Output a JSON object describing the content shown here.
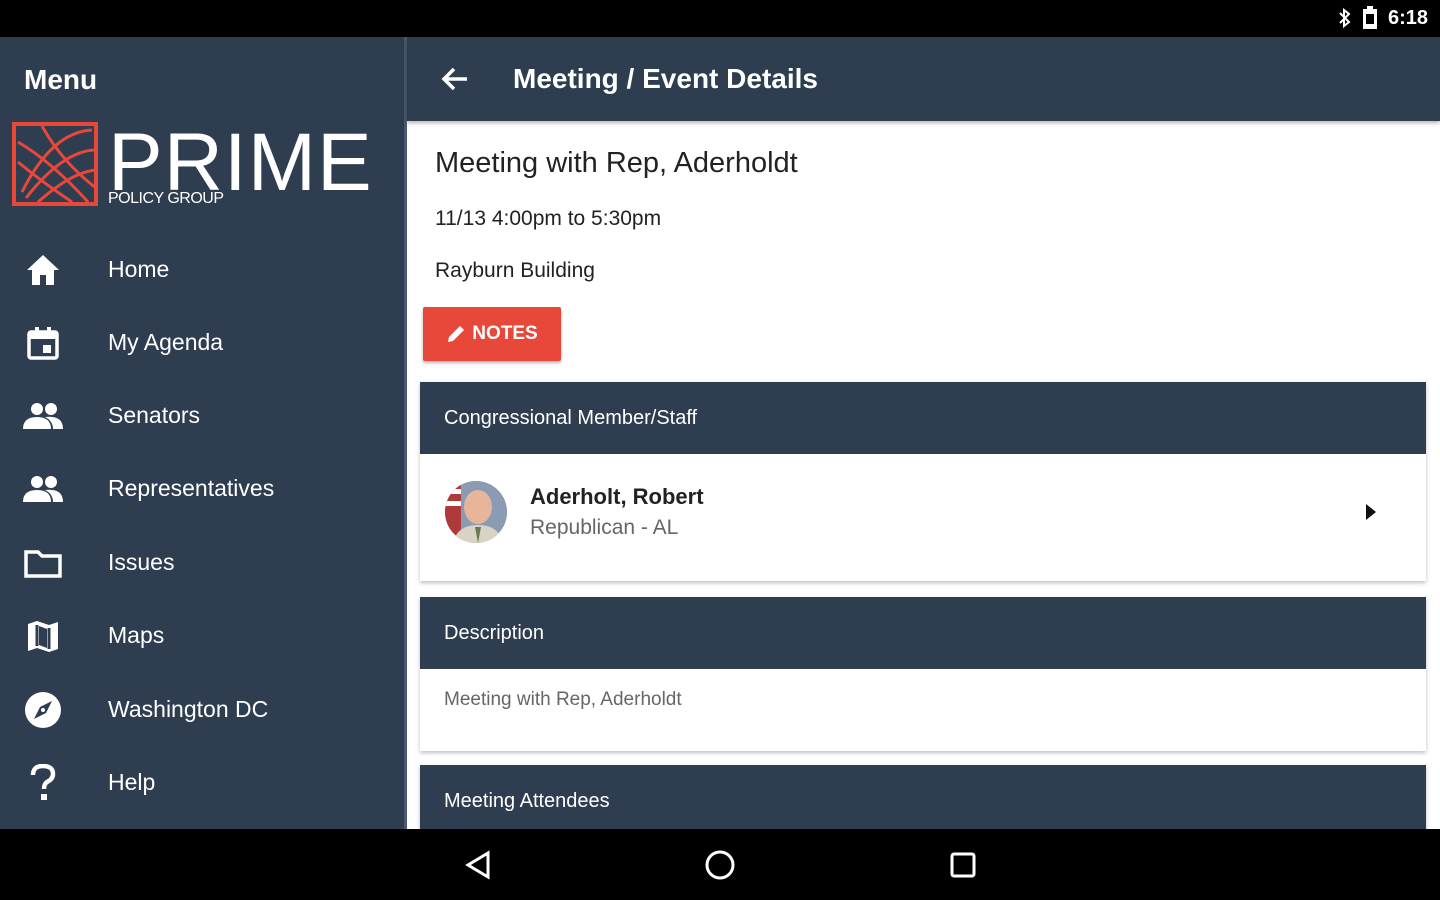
{
  "status_bar": {
    "time": "6:18",
    "icons": [
      "bluetooth-icon",
      "battery-icon"
    ]
  },
  "drawer": {
    "title": "Menu",
    "logo": {
      "wordmark": "PRIME",
      "subtitle": "POLICY GROUP"
    },
    "items": [
      {
        "label": "Home",
        "icon": "home-icon"
      },
      {
        "label": "My Agenda",
        "icon": "calendar-icon"
      },
      {
        "label": "Senators",
        "icon": "people-icon"
      },
      {
        "label": "Representatives",
        "icon": "people-icon"
      },
      {
        "label": "Issues",
        "icon": "folder-icon"
      },
      {
        "label": "Maps",
        "icon": "map-icon"
      },
      {
        "label": "Washington DC",
        "icon": "compass-icon"
      },
      {
        "label": "Help",
        "icon": "help-icon"
      }
    ]
  },
  "header": {
    "title": "Meeting / Event Details"
  },
  "meeting": {
    "title": "Meeting with Rep, Aderholdt",
    "time": "11/13 4:00pm to 5:30pm",
    "location": "Rayburn Building",
    "notes_label": "NOTES"
  },
  "member_card": {
    "header": "Congressional Member/Staff",
    "name": "Aderholt, Robert",
    "party": "Republican - AL"
  },
  "description_card": {
    "header": "Description",
    "text": "Meeting with Rep, Aderholdt"
  },
  "attendees_card": {
    "header": "Meeting Attendees"
  },
  "colors": {
    "primary": "#2e3d50",
    "accent": "#e8483a",
    "background": "#ffffff"
  }
}
